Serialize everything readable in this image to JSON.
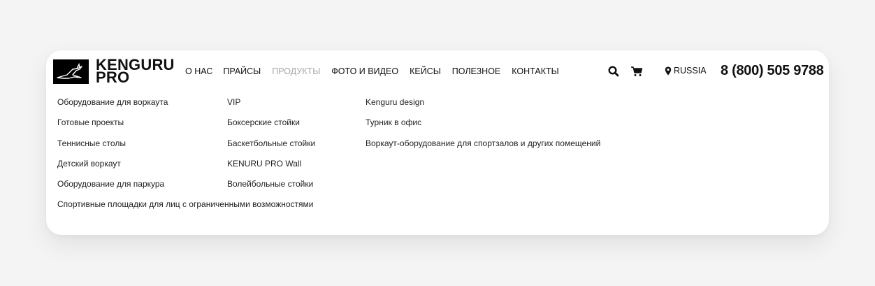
{
  "logo": {
    "line1": "KENGURU",
    "line2": "PRO"
  },
  "nav": {
    "items": [
      {
        "label": "О НАС",
        "name": "nav-about",
        "muted": false
      },
      {
        "label": "ПРАЙСЫ",
        "name": "nav-prices",
        "muted": false
      },
      {
        "label": "ПРОДУКТЫ",
        "name": "nav-products",
        "muted": true
      },
      {
        "label": "ФОТО И ВИДЕО",
        "name": "nav-photo-video",
        "muted": false
      },
      {
        "label": "КЕЙСЫ",
        "name": "nav-cases",
        "muted": false
      },
      {
        "label": "ПОЛЕЗНОЕ",
        "name": "nav-useful",
        "muted": false
      },
      {
        "label": "КОНТАКТЫ",
        "name": "nav-contacts",
        "muted": false
      }
    ]
  },
  "header": {
    "search_icon": "search-icon",
    "cart_icon": "cart-icon",
    "region_icon": "map-marker-icon",
    "region_label": "RUSSIA",
    "phone": "8 (800) 505 9788"
  },
  "menu": {
    "col1": [
      "Оборудование для воркаута",
      "Готовые проекты",
      "Теннисные столы",
      "Детский воркаут",
      "Оборудование для паркура",
      "Спортивные площадки для лиц с ограниченными возможностями"
    ],
    "col2": [
      "VIP",
      "Боксерские стойки",
      "Баскетбольные стойки",
      "KENURU PRO Wall",
      "Волейбольные стойки"
    ],
    "col3": [
      "Kenguru design",
      "Турник в офис",
      "Воркаут-оборудование для спортзалов и других помещений"
    ]
  },
  "colors": {
    "background": "#f4f4f4",
    "card": "#ffffff",
    "text": "#111111",
    "muted_nav": "#a7a7a7"
  }
}
